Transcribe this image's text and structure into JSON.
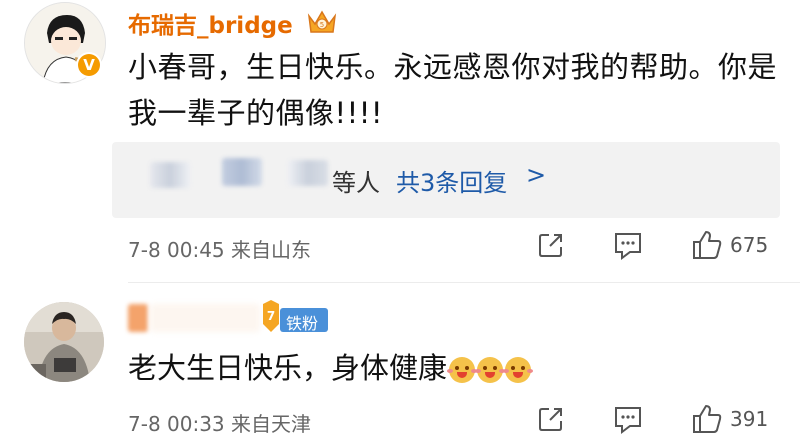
{
  "comments": [
    {
      "username": "布瑞吉_bridge",
      "text": "小春哥，生日快乐。永远感恩你对我的帮助。你是我一辈子的偶像!!!!",
      "reply_summary": {
        "suffix": "等人",
        "count_link": "共3条回复",
        "arrow": ">"
      },
      "meta": "7-8 00:45 来自山东",
      "likes": "675",
      "verified_color": "#f59b00"
    },
    {
      "username": "",
      "badge": "铁粉",
      "text": "老大生日快乐，身体健康",
      "emoji_count": 3,
      "meta": "7-8 00:33 来自天津",
      "likes": "391"
    }
  ],
  "colors": {
    "username": "#e66a00",
    "link": "#1e5aa8",
    "badge_bg": "#4a90d9"
  }
}
